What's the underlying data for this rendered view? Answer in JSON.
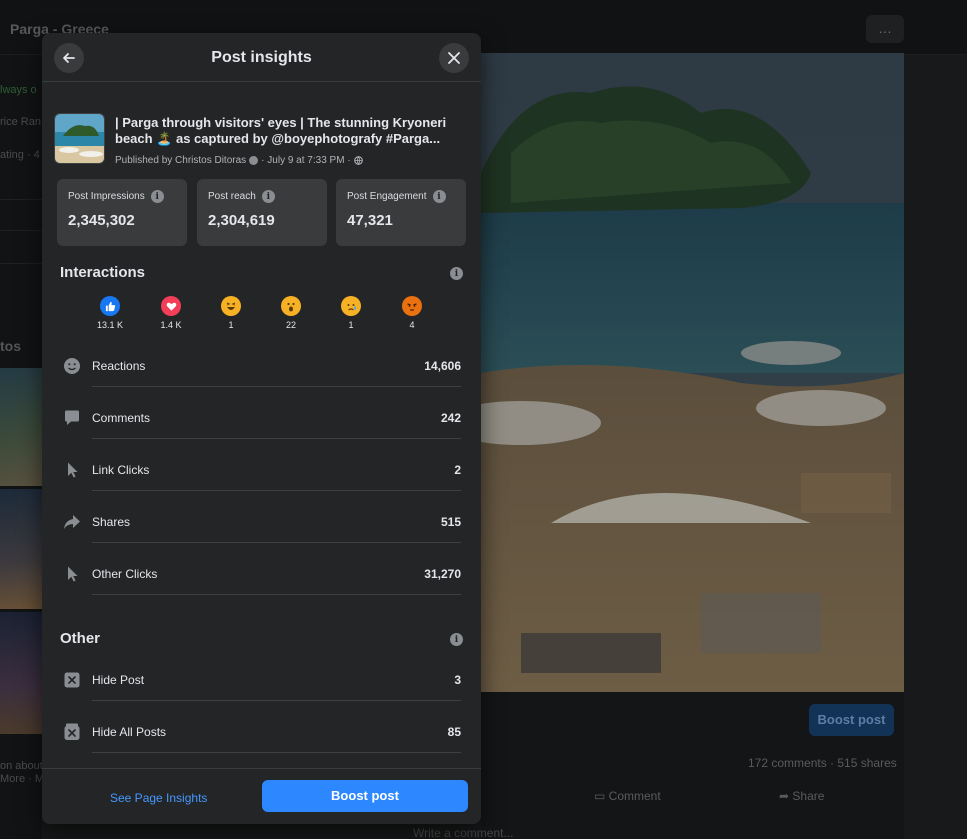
{
  "background": {
    "page_title": "Parga - Greece",
    "more_icon": "…",
    "left_texts": [
      "lways o",
      "rice Ran",
      "ating · 4",
      "tos",
      "on about",
      "More · M"
    ],
    "boost_label": "Boost post",
    "counts": "172 comments · 515 shares",
    "comment_label": "Comment",
    "share_label": "Share",
    "comment_placeholder": "Write a comment..."
  },
  "modal": {
    "title": "Post insights",
    "post": {
      "title_line1": "| Parga through visitors' eyes | The stunning Kryoneri",
      "title_line2": "beach 🏝️ as captured by @boyephotografy #Parga...",
      "author": "Published by Christos Ditoras",
      "date": "· July 9 at 7:33 PM ·"
    },
    "stats": [
      {
        "label": "Post Impressions",
        "value": "2,345,302"
      },
      {
        "label": "Post reach",
        "value": "2,304,619"
      },
      {
        "label": "Post Engagement",
        "value": "47,321"
      }
    ],
    "interactions_title": "Interactions",
    "reactions": [
      {
        "name": "like",
        "count": "13.1 K",
        "color": "#1877f2"
      },
      {
        "name": "love",
        "count": "1.4 K",
        "color": "#f33e58"
      },
      {
        "name": "haha",
        "count": "1",
        "color": "#f7b125"
      },
      {
        "name": "wow",
        "count": "22",
        "color": "#f7b125"
      },
      {
        "name": "sad",
        "count": "1",
        "color": "#f7b125"
      },
      {
        "name": "angry",
        "count": "4",
        "color": "#e9710f"
      }
    ],
    "metrics": [
      {
        "icon": "smiley-icon",
        "label": "Reactions",
        "value": "14,606"
      },
      {
        "icon": "comment-icon",
        "label": "Comments",
        "value": "242"
      },
      {
        "icon": "cursor-icon",
        "label": "Link Clicks",
        "value": "2"
      },
      {
        "icon": "share-icon",
        "label": "Shares",
        "value": "515"
      },
      {
        "icon": "cursor-icon",
        "label": "Other Clicks",
        "value": "31,270"
      }
    ],
    "other_title": "Other",
    "other_metrics": [
      {
        "icon": "hide-icon",
        "label": "Hide Post",
        "value": "3"
      },
      {
        "icon": "hide-all-icon",
        "label": "Hide All Posts",
        "value": "85"
      }
    ],
    "footer": {
      "see_insights": "See Page Insights",
      "boost": "Boost post"
    }
  },
  "colors": {
    "accent": "#2d88ff",
    "modal_bg": "#242526",
    "card_bg": "#3a3b3c"
  }
}
